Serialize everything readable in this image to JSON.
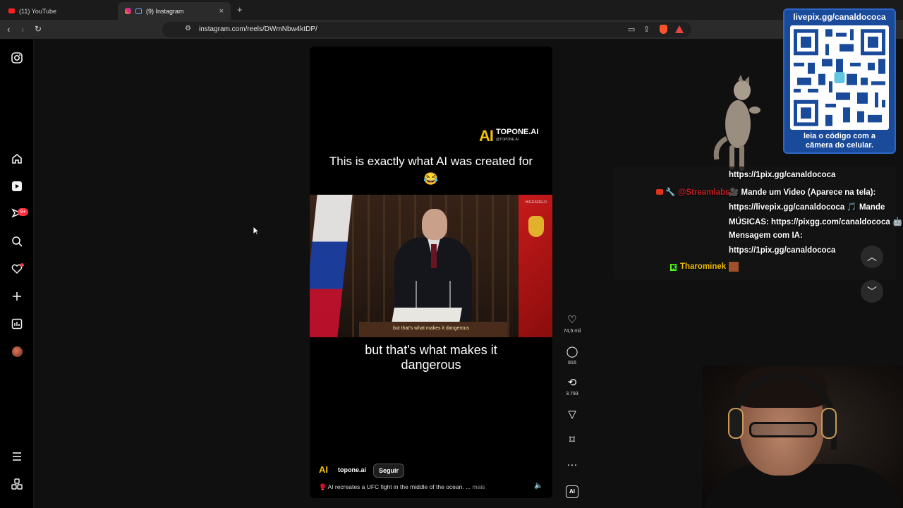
{
  "browser": {
    "tabs": [
      {
        "label": "(11) YouTube",
        "active": false
      },
      {
        "label": "(9) Instagram",
        "active": true
      }
    ],
    "url": "instagram.com/reels/DWmNbw4ktDP/"
  },
  "sidebar": {
    "notifications_badge": "9+"
  },
  "reel": {
    "brand": "TOPONE.AI",
    "brand_handle": "@TOPONE.AI",
    "brand_mark": "AI",
    "caption_top": "This is exactly what AI was created for 😂",
    "watermark": "HIGGSFIELD",
    "subtitle_in_video": "but that's what makes it dangerous",
    "caption_bottom": "but that's what makes it dangerous",
    "username": "topone.ai",
    "follow_label": "Seguir",
    "description": "AI recreates a UFC fight in the middle of the ocean. ...",
    "more_label": "mais"
  },
  "actions": {
    "likes": "74,5 mil",
    "comments": "816",
    "reposts": "3.793"
  },
  "overlay": {
    "qr_title": "livepix.gg/canaldococa",
    "qr_footer_1": "leia o código com a",
    "qr_footer_2": "câmera do celular.",
    "chat": {
      "line1": "https://1pix.gg/canaldococa",
      "streamlabs_name": "@Streamlabs",
      "line2": "Mande um Video (Aparece na tela):",
      "line3": "https://livepix.gg/canaldococa 🎵 Mande",
      "line4": "MÚSICAS: https://pixgg.com/canaldococa 🤖",
      "line5": "Mensagem com IA:",
      "line6": "https://1pix.gg/canaldococa",
      "user_name": "Tharominek"
    }
  }
}
